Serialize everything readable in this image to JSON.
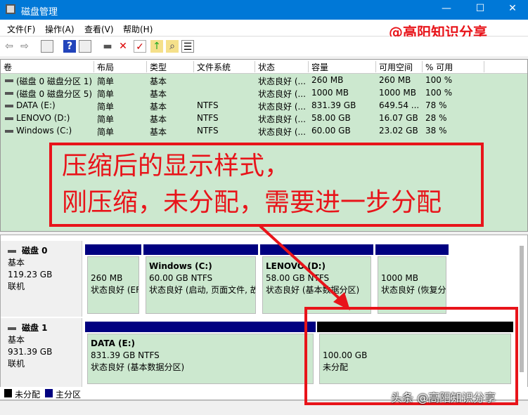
{
  "window": {
    "title": "磁盘管理",
    "min": "—",
    "max": "☐",
    "close": "✕"
  },
  "menu": [
    "文件(F)",
    "操作(A)",
    "查看(V)",
    "帮助(H)"
  ],
  "watermark_top": "@高阳知识分享",
  "watermark_bottom": "头条 @高阳知识分享",
  "toolbar": {
    "back": "⇦",
    "forward": "⇨",
    "delete": "✕",
    "help": "?"
  },
  "columns": [
    "卷",
    "布局",
    "类型",
    "文件系统",
    "状态",
    "容量",
    "可用空间",
    "% 可用"
  ],
  "rows": [
    [
      "(磁盘 0 磁盘分区 1)",
      "简单",
      "基本",
      "",
      "状态良好 (...",
      "260 MB",
      "260 MB",
      "100 %"
    ],
    [
      "(磁盘 0 磁盘分区 5)",
      "简单",
      "基本",
      "",
      "状态良好 (...",
      "1000 MB",
      "1000 MB",
      "100 %"
    ],
    [
      "DATA (E:)",
      "简单",
      "基本",
      "NTFS",
      "状态良好 (...",
      "831.39 GB",
      "649.54 ...",
      "78 %"
    ],
    [
      "LENOVO (D:)",
      "简单",
      "基本",
      "NTFS",
      "状态良好 (...",
      "58.00 GB",
      "16.07 GB",
      "28 %"
    ],
    [
      "Windows (C:)",
      "简单",
      "基本",
      "NTFS",
      "状态良好 (...",
      "60.00 GB",
      "23.02 GB",
      "38 %"
    ]
  ],
  "annotation": {
    "line1": "压缩后的显示样式，",
    "line2": "刚压缩，未分配，需要进一步分配"
  },
  "disks": [
    {
      "name": "磁盘 0",
      "type": "基本",
      "size": "119.23 GB",
      "state": "联机",
      "parts": [
        {
          "title": "",
          "l1": "260 MB",
          "l2": "状态良好 (EF"
        },
        {
          "title": "Windows  (C:)",
          "l1": "60.00 GB NTFS",
          "l2": "状态良好 (启动, 页面文件, 故"
        },
        {
          "title": "LENOVO  (D:)",
          "l1": "58.00 GB NTFS",
          "l2": "状态良好 (基本数据分区)"
        },
        {
          "title": "",
          "l1": "1000 MB",
          "l2": "状态良好 (恢复分"
        }
      ]
    },
    {
      "name": "磁盘 1",
      "type": "基本",
      "size": "931.39 GB",
      "state": "联机",
      "parts": [
        {
          "title": "DATA  (E:)",
          "l1": "831.39 GB NTFS",
          "l2": "状态良好 (基本数据分区)"
        },
        {
          "title": "",
          "l1": "100.00 GB",
          "l2": "未分配"
        }
      ]
    }
  ],
  "legend": {
    "unallocated": "未分配",
    "primary": "主分区"
  },
  "colors": {
    "primary": "#000080",
    "unallocated": "#000000",
    "partition_bg": "#cce8cf",
    "accent": "#e8141a",
    "titlebar": "#0078d7"
  }
}
